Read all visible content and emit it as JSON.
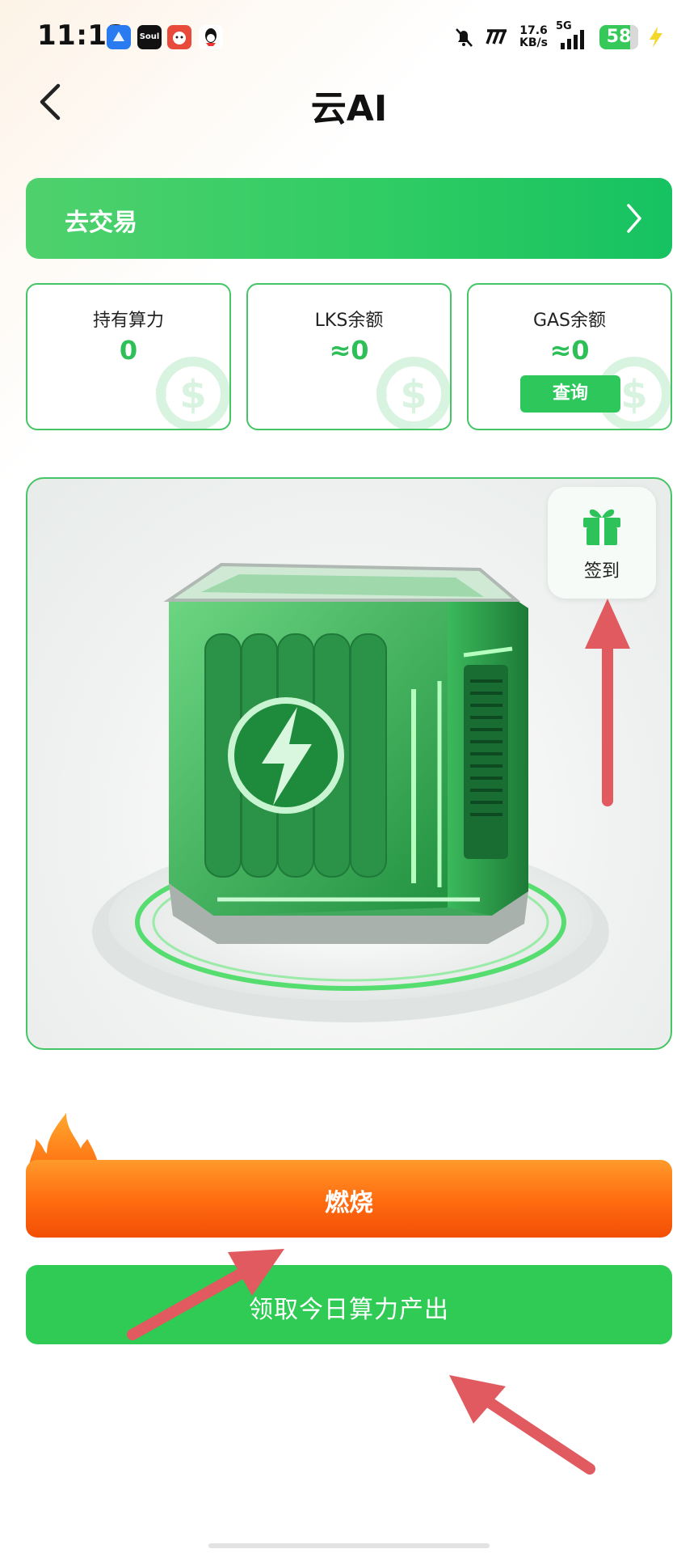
{
  "status_bar": {
    "time": "11:13",
    "app_icons": [
      "browser-icon",
      "soul-icon",
      "red-app-icon",
      "qq-icon"
    ],
    "soul_label": "Soul",
    "net_speed": "17.6",
    "net_unit": "KB/s",
    "network": "5G",
    "battery": "58"
  },
  "header": {
    "title": "云AI"
  },
  "trade_banner": {
    "label": "去交易"
  },
  "stats": [
    {
      "label": "持有算力",
      "value": "0"
    },
    {
      "label": "LKS余额",
      "value": "≈0"
    },
    {
      "label": "GAS余额",
      "value": "≈0",
      "button": "查询"
    }
  ],
  "hero": {
    "checkin_label": "签到"
  },
  "actions": {
    "burn_label": "燃烧",
    "claim_label": "领取今日算力产出"
  },
  "colors": {
    "primary_green": "#2fcb55",
    "burn_orange": "#ff6a0f",
    "annotation_arrow": "#e05a5f"
  }
}
